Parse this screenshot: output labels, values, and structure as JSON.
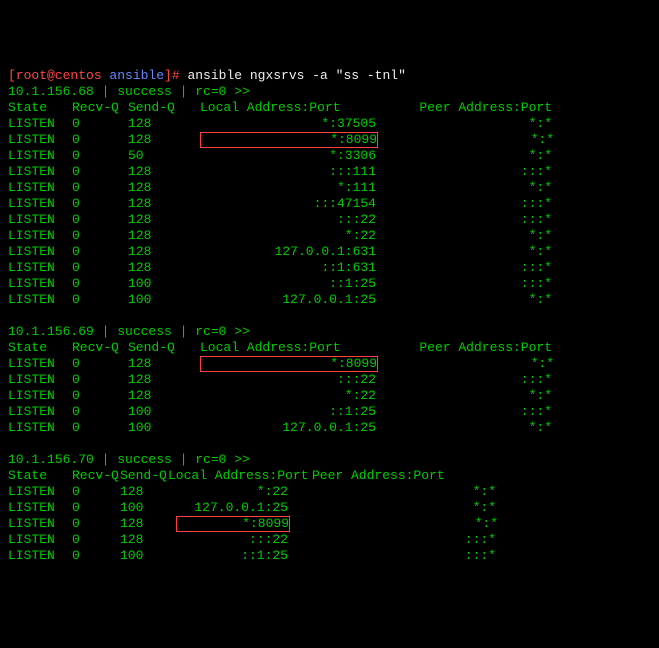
{
  "prompt": {
    "user": "[root@centos ",
    "path": "ansible",
    "close": "]# ",
    "cmd": "ansible ngxsrvs -a \"ss -tnl\""
  },
  "headers": {
    "state": "State",
    "recv": "Recv-Q",
    "send": "Send-Q",
    "laddr": "Local Address:Port",
    "paddr": "Peer Address:Port"
  },
  "hosts": [
    {
      "name": "10.1.156.68",
      "status": "success",
      "rc": "rc=0",
      "arrows": ">>",
      "rows": [
        {
          "state": "LISTEN",
          "recv": "0",
          "send": "128",
          "laddr": "*:37505",
          "paddr": "*:*",
          "hl": false
        },
        {
          "state": "LISTEN",
          "recv": "0",
          "send": "128",
          "laddr": "*:8099",
          "paddr": "*:*",
          "hl": true
        },
        {
          "state": "LISTEN",
          "recv": "0",
          "send": "50",
          "laddr": "*:3306",
          "paddr": "*:*",
          "hl": false
        },
        {
          "state": "LISTEN",
          "recv": "0",
          "send": "128",
          "laddr": ":::111",
          "paddr": ":::*",
          "hl": false
        },
        {
          "state": "LISTEN",
          "recv": "0",
          "send": "128",
          "laddr": "*:111",
          "paddr": "*:*",
          "hl": false
        },
        {
          "state": "LISTEN",
          "recv": "0",
          "send": "128",
          "laddr": ":::47154",
          "paddr": ":::*",
          "hl": false
        },
        {
          "state": "LISTEN",
          "recv": "0",
          "send": "128",
          "laddr": ":::22",
          "paddr": ":::*",
          "hl": false
        },
        {
          "state": "LISTEN",
          "recv": "0",
          "send": "128",
          "laddr": "*:22",
          "paddr": "*:*",
          "hl": false
        },
        {
          "state": "LISTEN",
          "recv": "0",
          "send": "128",
          "laddr": "127.0.0.1:631",
          "paddr": "*:*",
          "hl": false
        },
        {
          "state": "LISTEN",
          "recv": "0",
          "send": "128",
          "laddr": "::1:631",
          "paddr": ":::*",
          "hl": false
        },
        {
          "state": "LISTEN",
          "recv": "0",
          "send": "100",
          "laddr": "::1:25",
          "paddr": ":::*",
          "hl": false
        },
        {
          "state": "LISTEN",
          "recv": "0",
          "send": "100",
          "laddr": "127.0.0.1:25",
          "paddr": "*:*",
          "hl": false
        }
      ]
    },
    {
      "name": "10.1.156.69",
      "status": "success",
      "rc": "rc=0",
      "arrows": ">>",
      "rows": [
        {
          "state": "LISTEN",
          "recv": "0",
          "send": "128",
          "laddr": "*:8099",
          "paddr": "*:*",
          "hl": true
        },
        {
          "state": "LISTEN",
          "recv": "0",
          "send": "128",
          "laddr": ":::22",
          "paddr": ":::*",
          "hl": false
        },
        {
          "state": "LISTEN",
          "recv": "0",
          "send": "128",
          "laddr": "*:22",
          "paddr": "*:*",
          "hl": false
        },
        {
          "state": "LISTEN",
          "recv": "0",
          "send": "100",
          "laddr": "::1:25",
          "paddr": ":::*",
          "hl": false
        },
        {
          "state": "LISTEN",
          "recv": "0",
          "send": "100",
          "laddr": "127.0.0.1:25",
          "paddr": "*:*",
          "hl": false
        }
      ]
    },
    {
      "name": "10.1.156.70",
      "status": "success",
      "rc": "rc=0",
      "arrows": ">>",
      "rows": [
        {
          "state": "LISTEN",
          "recv": "0",
          "send": "128",
          "laddr": "*:22",
          "paddr": "*:*",
          "hl": false
        },
        {
          "state": "LISTEN",
          "recv": "0",
          "send": "100",
          "laddr": "127.0.0.1:25",
          "paddr": "*:*",
          "hl": false
        },
        {
          "state": "LISTEN",
          "recv": "0",
          "send": "128",
          "laddr": "*:8099",
          "paddr": "*:*",
          "hl": true
        },
        {
          "state": "LISTEN",
          "recv": "0",
          "send": "128",
          "laddr": ":::22",
          "paddr": ":::*",
          "hl": false
        },
        {
          "state": "LISTEN",
          "recv": "0",
          "send": "100",
          "laddr": "::1:25",
          "paddr": ":::*",
          "hl": false
        }
      ]
    }
  ]
}
